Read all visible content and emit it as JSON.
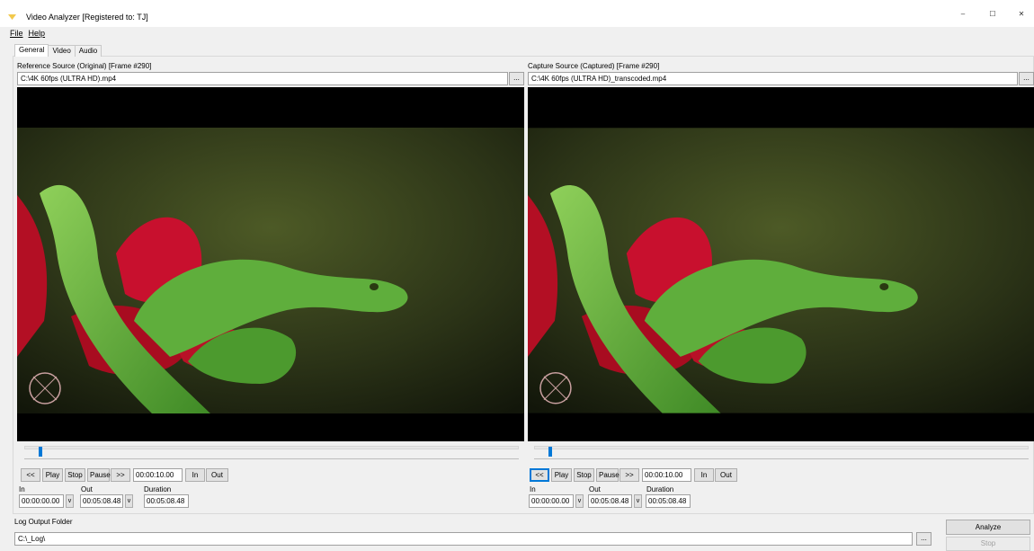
{
  "window": {
    "title": "Video Analyzer [Registered to: TJ]",
    "minimize_glyph": "–",
    "maximize_glyph": "☐",
    "close_glyph": "✕",
    "icon": "app-icon"
  },
  "menu": [
    "File",
    "Help"
  ],
  "tabs": [
    "General",
    "Video",
    "Audio"
  ],
  "active_tab": "General",
  "reference": {
    "label": "Reference Source (Original) [Frame #290]",
    "path": "C:\\4K 60fps (ULTRA HD).mp4",
    "browse_label": "...",
    "slider_position": 0.03
  },
  "capture": {
    "label": "Capture Source (Captured) [Frame #290]",
    "path": "C:\\4K 60fps (ULTRA HD)_transcoded.mp4",
    "browse_label": "...",
    "slider_position": 0.03
  },
  "controls": {
    "rewind": "<<",
    "play": "Play",
    "stop": "Stop",
    "pause": "Pause",
    "forward": ">>",
    "seek_time": "00:00:10.00",
    "in_button": "In",
    "out_button": "Out",
    "in_label": "In",
    "out_label": "Out",
    "duration_label": "Duration",
    "in_value": "00:00:00.00",
    "out_value": "00:05:08.48",
    "duration_value": "00:05:08.48",
    "dropdown_glyph": "v"
  },
  "log": {
    "label": "Log Output Folder",
    "path": "C:\\_Log\\",
    "browse_label": "..."
  },
  "actions": {
    "analyze": "Analyze",
    "stop": "Stop"
  },
  "colors": {
    "accent": "#0078d7",
    "window_bg": "#f0f0f0",
    "video_bg": "#000000",
    "snake_green": "#5fae3c",
    "flower_red": "#c8102e",
    "icon_yellow": "#f2c94c"
  }
}
